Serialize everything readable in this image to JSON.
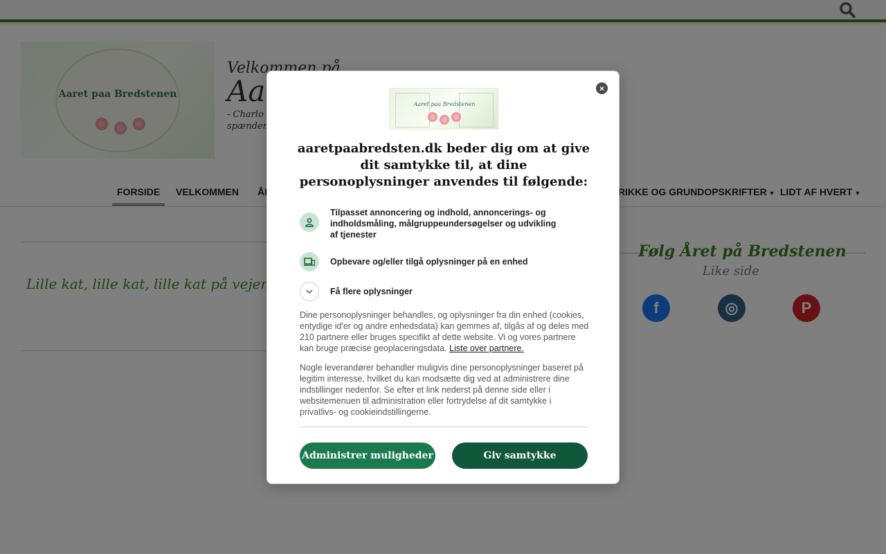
{
  "header": {
    "banner_text": "Aaret paa Bredstenen",
    "tagline_line1": "Velkommen på",
    "tagline_line2": "Aa",
    "tagline_line3": "- Charlo",
    "tagline_line4": "spænden"
  },
  "nav": {
    "items": [
      {
        "label": "FORSIDE",
        "active": true
      },
      {
        "label": "VELKOMMEN"
      },
      {
        "label": "ÅR"
      },
      {
        "label": "RIKKE OG GRUNDOPSKRIFTER",
        "has_dropdown": true
      },
      {
        "label": "LIDT AF HVERT",
        "has_dropdown": true
      }
    ],
    "search_icon": "search-icon"
  },
  "content": {
    "excerpt": "Lille kat, lille kat, lille kat på vejen. H"
  },
  "sidebar": {
    "follow_heading": "Følg Året på Bredstenen",
    "like_text": "Like side",
    "social": [
      {
        "name": "facebook",
        "glyph": "f",
        "color": "#1877f2"
      },
      {
        "name": "instagram",
        "glyph": "◎",
        "color": "#306088"
      },
      {
        "name": "pinterest",
        "glyph": "P",
        "color": "#d0232a"
      }
    ]
  },
  "consent": {
    "close_glyph": "×",
    "title": "aaretpaabredsten.dk beder dig om at give dit samtykke til, at dine personoplysninger anvendes til følgende:",
    "purposes": [
      {
        "icon": "person-icon",
        "text": "Tilpasset annoncering og indhold, annoncerings- og indholdsmåling, målgruppeundersøgelser og udvikling af tjenester"
      },
      {
        "icon": "devices-icon",
        "text": "Opbevare og/eller tilgå oplysninger på en enhed"
      },
      {
        "icon": "chevron-down-icon",
        "text": "Få flere oplysninger"
      }
    ],
    "paragraph1": "Dine personoplysninger behandles, og oplysninger fra din enhed (cookies, entydige id'er og andre enhedsdata) kan gemmes af, tilgås af og deles med 210 partnere eller bruges specifikt af dette website. Vi og vores partnere kan bruge præcise geoplaceringsdata.",
    "partners_link": "Liste over partnere.",
    "paragraph2": "Nogle leverandører behandler muligvis dine personoplysninger baseret på legitim interesse, hvilket du kan modsætte dig ved at administrere dine indstillinger nedenfor. Se efter et link nederst på denne side eller i websitemenuen til administration eller fortrydelse af dit samtykke i privatlivs- og cookieindstillingerne.",
    "manage_button": "Administrer muligheder",
    "consent_button": "Giv samtykke"
  },
  "colors": {
    "accent_green": "#3f7d20",
    "button_manage": "#1a7a4e",
    "button_consent": "#11573a"
  }
}
